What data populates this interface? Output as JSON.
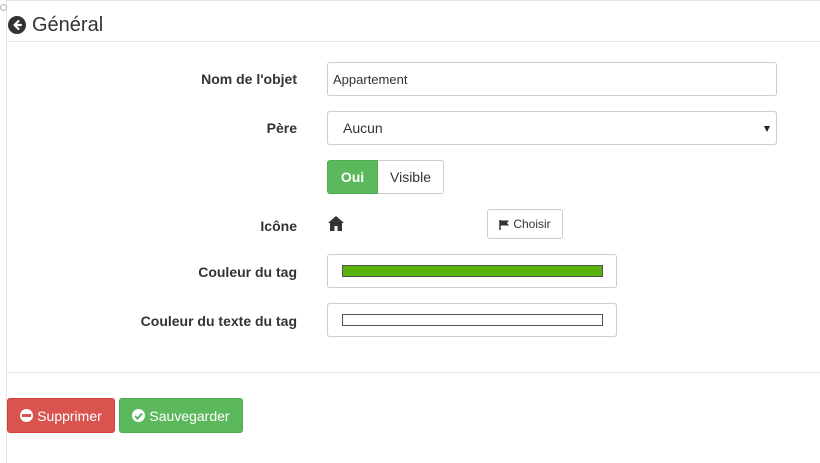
{
  "header": {
    "title": "Général",
    "back_icon": "arrow-circle-left-icon"
  },
  "form": {
    "name": {
      "label": "Nom de l'objet",
      "value": "Appartement"
    },
    "parent": {
      "label": "Père",
      "selected": "Aucun"
    },
    "visible": {
      "on_label": "Oui",
      "label": "Visible",
      "active": true,
      "on_color": "#5cb85c"
    },
    "icon": {
      "label": "Icône",
      "current_icon": "home-icon",
      "choose_label": "Choisir",
      "choose_icon": "flag-icon"
    },
    "tag_color": {
      "label": "Couleur du tag",
      "value": "#5ab30d"
    },
    "tag_text_color": {
      "label": "Couleur du texte du tag",
      "value": "#ffffff"
    }
  },
  "actions": {
    "delete_label": "Supprimer",
    "delete_color": "#d9534f",
    "save_label": "Sauvegarder",
    "save_color": "#5cb85c"
  }
}
